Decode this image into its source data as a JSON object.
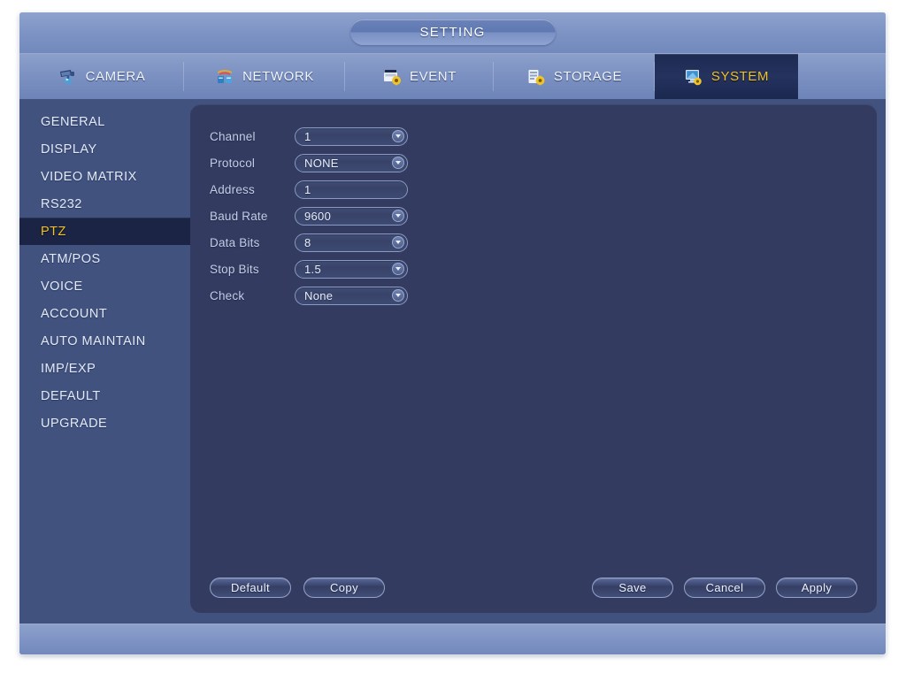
{
  "window": {
    "title": "SETTING"
  },
  "tabs": [
    {
      "label": "CAMERA",
      "icon": "camera-icon",
      "active": false
    },
    {
      "label": "NETWORK",
      "icon": "network-icon",
      "active": false
    },
    {
      "label": "EVENT",
      "icon": "event-icon",
      "active": false
    },
    {
      "label": "STORAGE",
      "icon": "storage-icon",
      "active": false
    },
    {
      "label": "SYSTEM",
      "icon": "system-icon",
      "active": true
    }
  ],
  "sidebar": {
    "items": [
      {
        "label": "GENERAL",
        "active": false
      },
      {
        "label": "DISPLAY",
        "active": false
      },
      {
        "label": "VIDEO MATRIX",
        "active": false
      },
      {
        "label": "RS232",
        "active": false
      },
      {
        "label": "PTZ",
        "active": true
      },
      {
        "label": "ATM/POS",
        "active": false
      },
      {
        "label": "VOICE",
        "active": false
      },
      {
        "label": "ACCOUNT",
        "active": false
      },
      {
        "label": "AUTO MAINTAIN",
        "active": false
      },
      {
        "label": "IMP/EXP",
        "active": false
      },
      {
        "label": "DEFAULT",
        "active": false
      },
      {
        "label": "UPGRADE",
        "active": false
      }
    ]
  },
  "form": {
    "fields": [
      {
        "label": "Channel",
        "value": "1",
        "type": "select"
      },
      {
        "label": "Protocol",
        "value": "NONE",
        "type": "select"
      },
      {
        "label": "Address",
        "value": "1",
        "type": "text"
      },
      {
        "label": "Baud Rate",
        "value": "9600",
        "type": "select"
      },
      {
        "label": "Data Bits",
        "value": "8",
        "type": "select"
      },
      {
        "label": "Stop Bits",
        "value": "1.5",
        "type": "select"
      },
      {
        "label": "Check",
        "value": "None",
        "type": "select"
      }
    ]
  },
  "buttons": {
    "left": [
      {
        "label": "Default"
      },
      {
        "label": "Copy"
      }
    ],
    "right": [
      {
        "label": "Save"
      },
      {
        "label": "Cancel"
      },
      {
        "label": "Apply"
      }
    ]
  },
  "colors": {
    "window_bg": "#6d84ba",
    "sidebar_bg": "#42527e",
    "content_bg": "#333c60",
    "active_tab_bg": "#1d2a52",
    "active_accent": "#f0c32a",
    "field_border": "#8a9ac4",
    "text": "#e4eaf6"
  }
}
